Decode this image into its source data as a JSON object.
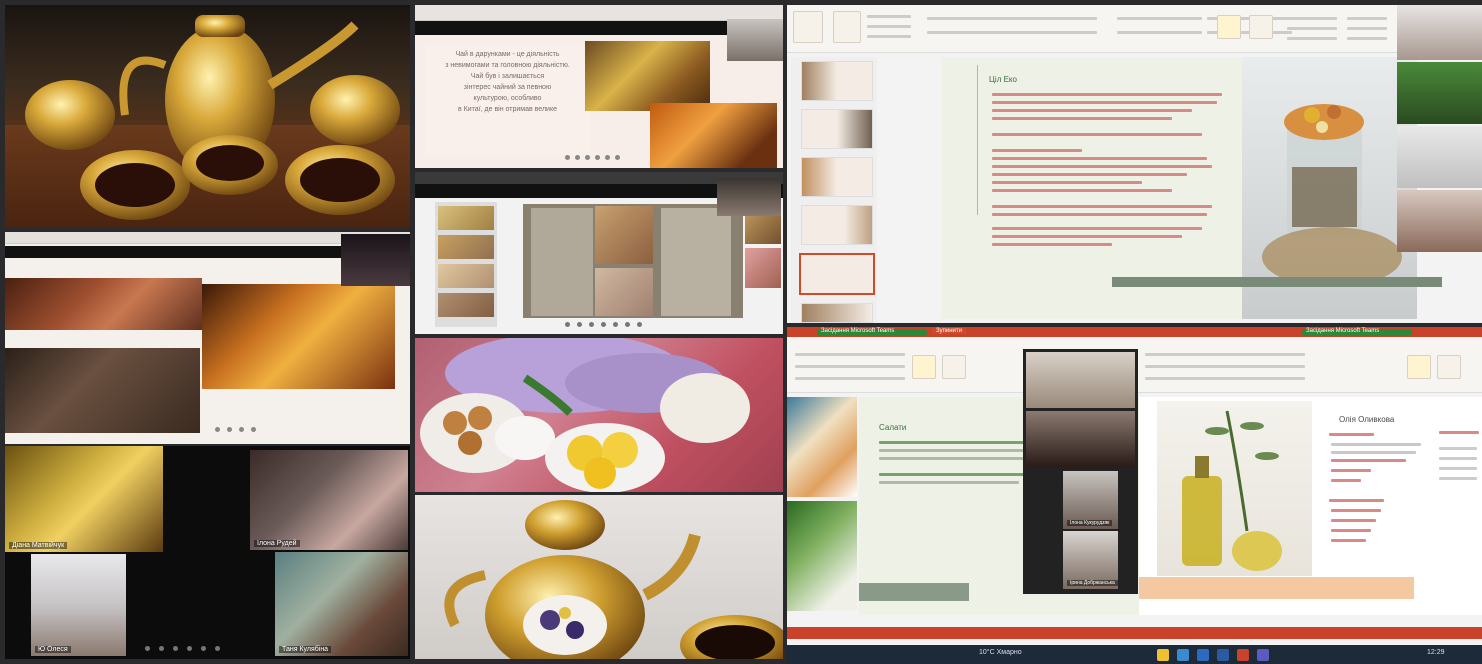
{
  "quadrants": {
    "top_left": {
      "slide_text": "Чай в дарунками - це діяльність\nз невимогами та головною діяльністю.\nЧай був і залишається\nзінтерес чайний за певною\nкультурою, особливо\nв Китаї, де він отримав велике"
    },
    "video_call_left": {
      "participants": [
        {
          "name": "Діана Матвійчук"
        },
        {
          "name": "Ілона Рудей"
        },
        {
          "name": "Ю Олеся"
        },
        {
          "name": "Таня Кулябіна"
        }
      ]
    },
    "powerpoint_top": {
      "slide_title": "Ціл Еко",
      "video_names": [
        "",
        "",
        "",
        ""
      ]
    },
    "bottom_right": {
      "left_slide_title": "Салати",
      "right_slide_title": "Олія Оливкова",
      "meeting_tab_1": "Засідання Microsoft Teams",
      "meeting_tab_2": "Засідання Microsoft Teams",
      "stop_btn": "Зупинити",
      "zoom_names": [
        "",
        "",
        "Ілона Кукурудзяк",
        "Ірина Добржанська"
      ]
    },
    "taskbar": {
      "weather": "10°C Хмарно",
      "time": "12:29"
    }
  },
  "colors": {
    "accent_orange": "#d04a2a",
    "ppt_orange": "#c9432b",
    "slide_bg": "#eef2e6",
    "dark_bg": "#1c1c1c"
  }
}
